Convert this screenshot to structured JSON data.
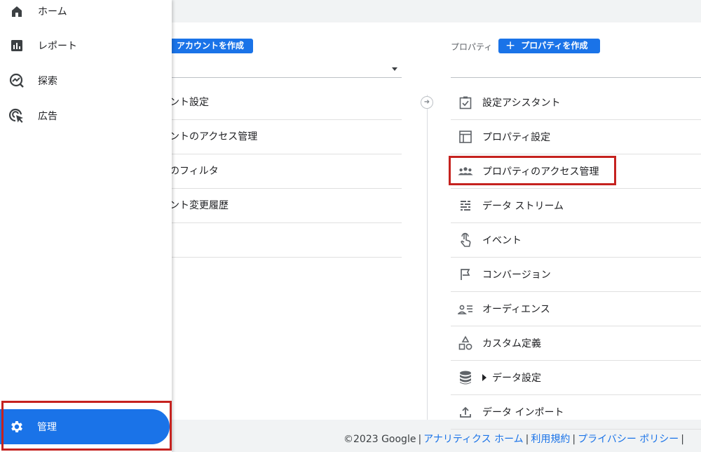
{
  "sidebar": {
    "items": [
      {
        "label": "ホーム",
        "icon": "home-icon"
      },
      {
        "label": "レポート",
        "icon": "reports-icon"
      },
      {
        "label": "探索",
        "icon": "explore-icon"
      },
      {
        "label": "広告",
        "icon": "advertising-icon"
      }
    ],
    "admin": {
      "label": "管理",
      "icon": "gear-icon"
    }
  },
  "account": {
    "create_button": "アカウントを作成",
    "items": [
      "ント設定",
      "ントのアクセス管理",
      "のフィルタ",
      "ント変更履歴"
    ]
  },
  "property": {
    "label": "プロパティ",
    "create_button": "プロパティを作成",
    "items": [
      {
        "label": "設定アシスタント",
        "icon": "checklist-icon"
      },
      {
        "label": "プロパティ設定",
        "icon": "property-settings-icon"
      },
      {
        "label": "プロパティのアクセス管理",
        "icon": "people-icon"
      },
      {
        "label": "データ ストリーム",
        "icon": "data-streams-icon"
      },
      {
        "label": "イベント",
        "icon": "touch-icon"
      },
      {
        "label": "コンバージョン",
        "icon": "flag-icon"
      },
      {
        "label": "オーディエンス",
        "icon": "audience-icon"
      },
      {
        "label": "カスタム定義",
        "icon": "shapes-icon"
      },
      {
        "label": "データ設定",
        "icon": "database-icon"
      },
      {
        "label": "データ インポート",
        "icon": "upload-icon"
      }
    ]
  },
  "footer": {
    "copyright": "©2023 Google",
    "links": [
      "アナリティクス ホーム",
      "利用規約",
      "プライバシー ポリシー"
    ]
  },
  "colors": {
    "accent": "#1a73e8",
    "highlight": "#c5221f"
  }
}
